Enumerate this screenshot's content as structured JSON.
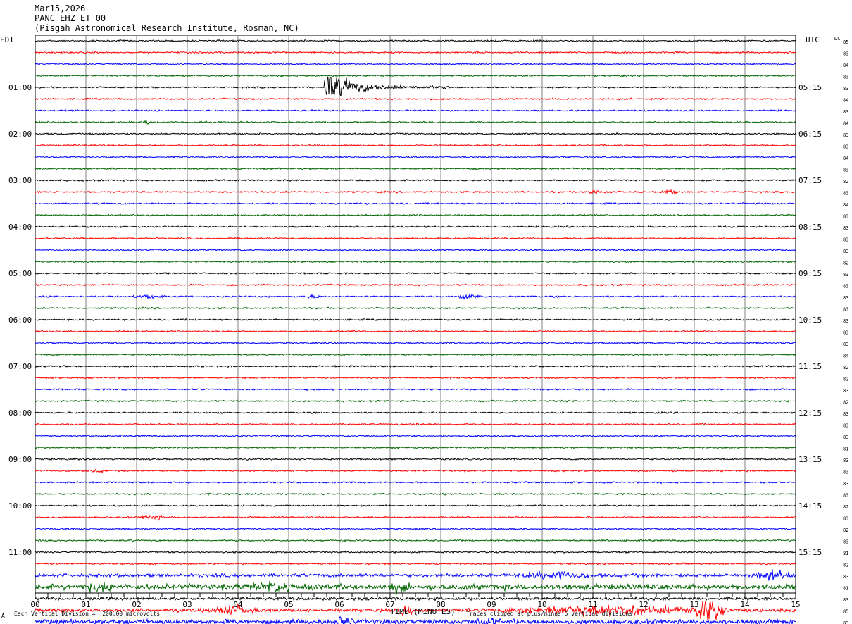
{
  "header": {
    "date": "Mar15,2026",
    "station": "PANC EHZ ET 00",
    "location": "(Pisgah Astronomical Research Institute, Rosman, NC)"
  },
  "left_tz": "EDT",
  "right_tz": "UTC",
  "dc_label": "DC",
  "footer": {
    "scale": "Each Vertical Division =  200.00 microvolts",
    "clip": "Traces clipped at plus/minus 5 vertical divisions",
    "mark": "A"
  },
  "colors": {
    "trace_cycle": [
      "#000000",
      "#ff0000",
      "#0000ff",
      "#006400"
    ],
    "grid": "#808080"
  },
  "chart_data": {
    "type": "line",
    "title": "PANC EHZ ET 00",
    "xlabel": "TIME (MINUTES)",
    "x_ticks": [
      "00",
      "01",
      "02",
      "03",
      "04",
      "05",
      "06",
      "07",
      "08",
      "09",
      "10",
      "11",
      "12",
      "13",
      "14",
      "15"
    ],
    "xlim": [
      0,
      15
    ],
    "left_labels": [
      "01:00",
      "02:00",
      "03:00",
      "04:00",
      "05:00",
      "06:00",
      "07:00",
      "08:00",
      "09:00",
      "10:00",
      "11:00"
    ],
    "right_labels": [
      "05:15",
      "06:15",
      "07:15",
      "08:15",
      "09:15",
      "10:15",
      "11:15",
      "12:15",
      "13:15",
      "14:15",
      "15:15"
    ],
    "label_every": 4,
    "label_first_trace": 4,
    "dc_values": [
      "85",
      "83",
      "84",
      "83",
      "83",
      "84",
      "83",
      "84",
      "83",
      "83",
      "84",
      "83",
      "82",
      "83",
      "84",
      "83",
      "83",
      "83",
      "83",
      "82",
      "83",
      "83",
      "83",
      "83",
      "83",
      "83",
      "83",
      "84",
      "82",
      "82",
      "83",
      "82",
      "83",
      "83",
      "83",
      "81",
      "83",
      "83",
      "83",
      "83",
      "82",
      "83",
      "82",
      "83",
      "81",
      "82",
      "83",
      "81",
      "83",
      "85",
      "83"
    ],
    "events": [
      {
        "trace": 4,
        "start_min": 5.7,
        "duration_min": 2.5,
        "amplitude": 16,
        "kind": "quake"
      },
      {
        "trace": 7,
        "start_min": 2.0,
        "duration_min": 0.4,
        "amplitude": 1.5
      },
      {
        "trace": 13,
        "start_min": 10.8,
        "duration_min": 0.6,
        "amplitude": 1.5
      },
      {
        "trace": 13,
        "start_min": 12.3,
        "duration_min": 0.5,
        "amplitude": 1.2
      },
      {
        "trace": 22,
        "start_min": 1.8,
        "duration_min": 0.8,
        "amplitude": 1.4
      },
      {
        "trace": 22,
        "start_min": 5.2,
        "duration_min": 0.5,
        "amplitude": 1.3
      },
      {
        "trace": 22,
        "start_min": 8.3,
        "duration_min": 0.6,
        "amplitude": 2.2
      },
      {
        "trace": 33,
        "start_min": 7.3,
        "duration_min": 0.4,
        "amplitude": 1.2
      },
      {
        "trace": 37,
        "start_min": 1.0,
        "duration_min": 0.5,
        "amplitude": 1.2
      },
      {
        "trace": 41,
        "start_min": 2.0,
        "duration_min": 0.6,
        "amplitude": 2.5
      },
      {
        "trace": 46,
        "start_min": 9.5,
        "duration_min": 1.5,
        "amplitude": 3.0
      },
      {
        "trace": 46,
        "start_min": 14.1,
        "duration_min": 0.9,
        "amplitude": 4.0
      },
      {
        "trace": 47,
        "start_min": 0.9,
        "duration_min": 0.8,
        "amplitude": 3.0
      },
      {
        "trace": 47,
        "start_min": 4.1,
        "duration_min": 1.2,
        "amplitude": 3.5
      },
      {
        "trace": 47,
        "start_min": 6.9,
        "duration_min": 0.5,
        "amplitude": 3.0
      },
      {
        "trace": 49,
        "start_min": 3.4,
        "duration_min": 1.0,
        "amplitude": 4.0
      },
      {
        "trace": 49,
        "start_min": 7.1,
        "duration_min": 0.4,
        "amplitude": 4.0
      },
      {
        "trace": 49,
        "start_min": 9.0,
        "duration_min": 4.5,
        "amplitude": 4.0
      },
      {
        "trace": 49,
        "start_min": 12.9,
        "duration_min": 0.8,
        "amplitude": 11.0
      },
      {
        "trace": 50,
        "start_min": 5.8,
        "duration_min": 0.5,
        "amplitude": 4.0
      },
      {
        "trace": 50,
        "start_min": 8.6,
        "duration_min": 0.6,
        "amplitude": 3.0
      },
      {
        "trace": 51,
        "start_min": 0.8,
        "duration_min": 1.6,
        "amplitude": 4.0
      },
      {
        "trace": 51,
        "start_min": 5.5,
        "duration_min": 0.8,
        "amplitude": 3.0
      }
    ],
    "noise_levels": {
      "46": 1.8,
      "47": 3.0,
      "48": 1.5,
      "49": 1.8,
      "50": 2.5,
      "51": 2.2
    },
    "base_noise": 0.8,
    "grid": true
  }
}
